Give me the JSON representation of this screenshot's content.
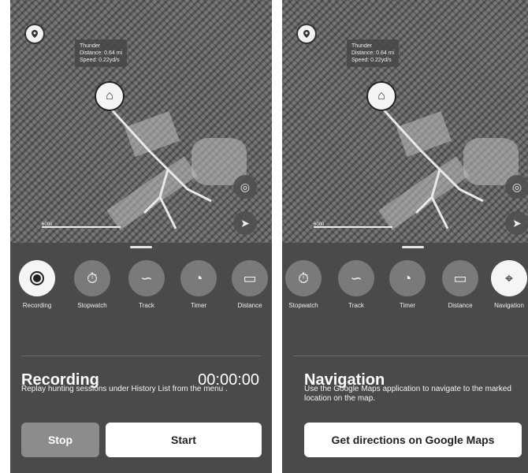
{
  "left_screen": {
    "map": {
      "info_label": {
        "name": "Thunder",
        "distance": "Distance: 0.64 mi",
        "speed": "Speed: 0.22yd/s"
      },
      "scale_label": "6000"
    },
    "tools": [
      {
        "label": "Recording",
        "icon": "record-icon",
        "active": true
      },
      {
        "label": "Stopwatch",
        "icon": "stopwatch-icon",
        "active": false
      },
      {
        "label": "Track",
        "icon": "track-icon",
        "active": false
      },
      {
        "label": "Timer",
        "icon": "timer-icon",
        "active": false
      },
      {
        "label": "Distance",
        "icon": "ruler-icon",
        "active": false
      }
    ],
    "section": {
      "title": "Recording",
      "timer": "00:00:00",
      "description": "Replay hunting sessions under History List from the menu ."
    },
    "buttons": {
      "stop": "Stop",
      "start": "Start"
    }
  },
  "right_screen": {
    "map": {
      "info_label": {
        "name": "Thunder",
        "distance": "Distance: 0.64 mi",
        "speed": "Speed: 0.22yd/s"
      },
      "scale_label": "6000"
    },
    "tools": [
      {
        "label": "Stopwatch",
        "icon": "stopwatch-icon",
        "active": false
      },
      {
        "label": "Track",
        "icon": "track-icon",
        "active": false
      },
      {
        "label": "Timer",
        "icon": "timer-icon",
        "active": false
      },
      {
        "label": "Distance",
        "icon": "ruler-icon",
        "active": false
      },
      {
        "label": "Navigation",
        "icon": "map-pin-icon",
        "active": true
      }
    ],
    "section": {
      "title": "Navigation",
      "description": "Use the Google Maps application to navigate to the marked location on the map."
    },
    "buttons": {
      "google_maps": "Get directions on Google Maps"
    }
  },
  "colors": {
    "sheet_bg": "#4a4a4a",
    "tool_circle": "#7a7a7a",
    "active_circle": "#f5f5f5",
    "stop_button": "#8c8c8c"
  }
}
